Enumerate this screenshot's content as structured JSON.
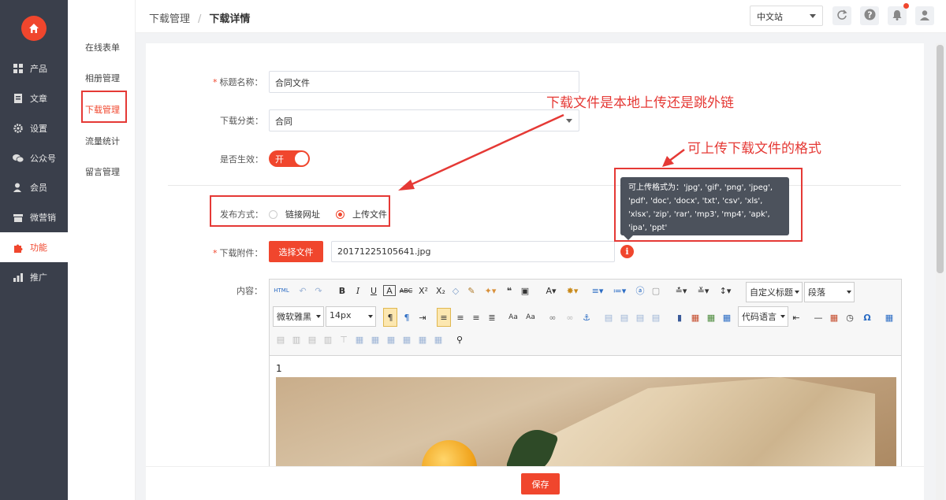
{
  "sidebar": {
    "items": [
      {
        "label": "产品",
        "icon": "grid-icon"
      },
      {
        "label": "文章",
        "icon": "document-icon"
      },
      {
        "label": "设置",
        "icon": "gear-icon"
      },
      {
        "label": "公众号",
        "icon": "wechat-icon"
      },
      {
        "label": "会员",
        "icon": "user-icon"
      },
      {
        "label": "微营销",
        "icon": "store-icon"
      },
      {
        "label": "功能",
        "icon": "puzzle-icon"
      },
      {
        "label": "推广",
        "icon": "chart-icon"
      }
    ],
    "active_index": 6
  },
  "subnav": {
    "items": [
      "在线表单",
      "相册管理",
      "下载管理",
      "流量统计",
      "留言管理"
    ],
    "active_index": 2
  },
  "header": {
    "breadcrumb_parent": "下载管理",
    "breadcrumb_current": "下载详情",
    "site_select": "中文站"
  },
  "form": {
    "title_label": "标题名称：",
    "title_value": "合同文件",
    "category_label": "下载分类：",
    "category_value": "合同",
    "enabled_label": "是否生效：",
    "enabled_text": "开",
    "publish_label": "发布方式：",
    "publish_options": [
      "链接网址",
      "上传文件"
    ],
    "publish_selected": 1,
    "attachment_label": "下载附件：",
    "choose_file_label": "选择文件",
    "file_name": "20171225105641.jpg",
    "tooltip_title": "可上传格式为：",
    "tooltip_formats": "'jpg', 'gif', 'png', 'jpeg', 'pdf', 'doc', 'docx', 'txt', 'csv', 'xls', 'xlsx', 'zip', 'rar', 'mp3', 'mp4', 'apk', 'ipa', 'ppt'",
    "content_label": "内容："
  },
  "editor": {
    "heading_select": "自定义标题",
    "paragraph_select": "段落",
    "font_select": "微软雅黑",
    "size_select": "14px",
    "code_select": "代码语言",
    "first_line": "1"
  },
  "annotations": {
    "publish_note": "下载文件是本地上传还是跳外链",
    "format_note": "可上传下载文件的格式"
  },
  "footer": {
    "save_label": "保存"
  },
  "colors": {
    "accent": "#f0462d",
    "sidebar_bg": "#3a3f4b",
    "annotation": "#e53935"
  }
}
